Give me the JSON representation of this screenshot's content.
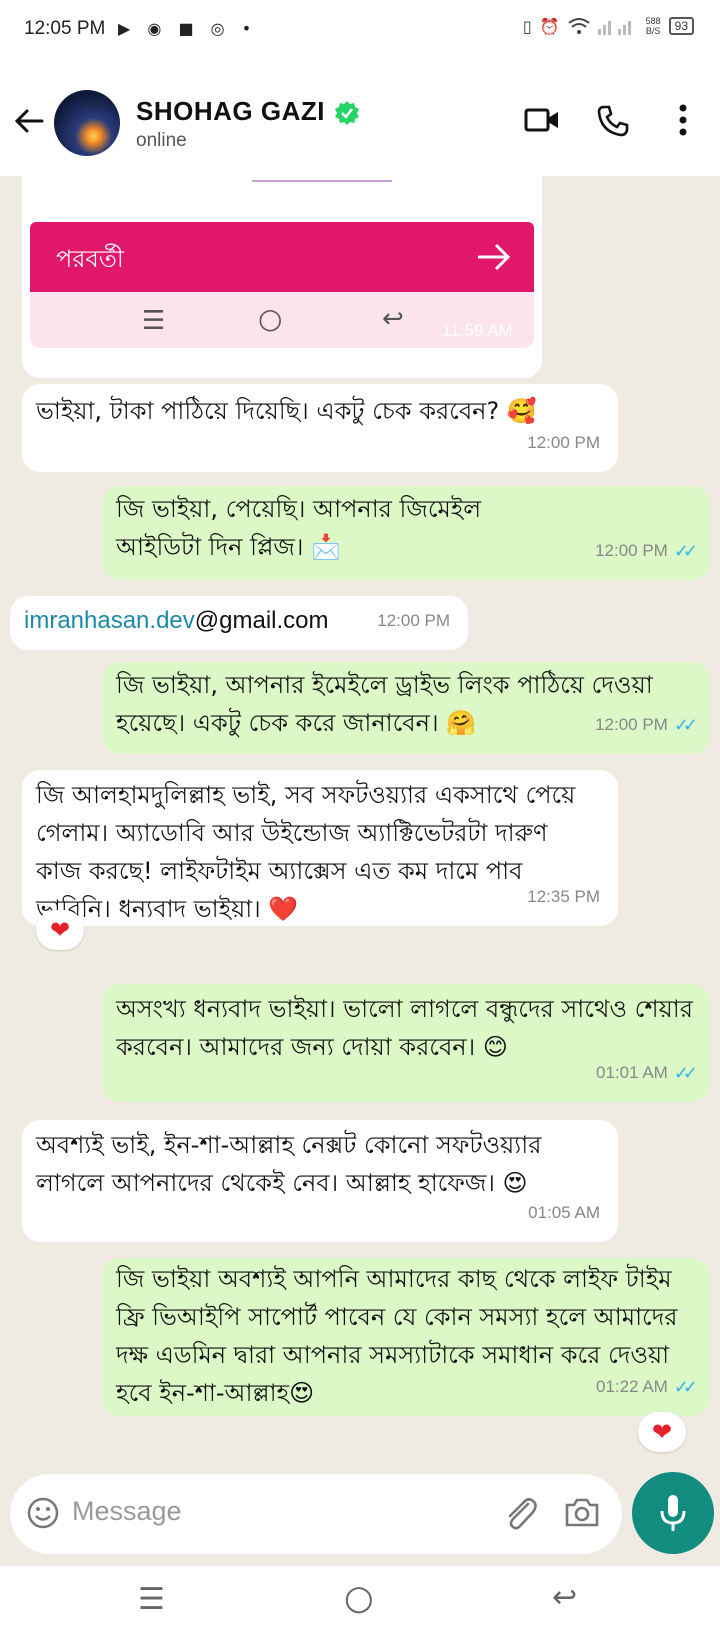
{
  "status_bar": {
    "time": "12:05 PM",
    "net_speed_top": "588",
    "net_speed_bottom": "B/S",
    "battery": "93"
  },
  "header": {
    "contact_name": "SHOHAG GAZI",
    "presence": "online"
  },
  "shared_screenshot": {
    "button_label": "পরবর্তী",
    "time": "11:59 AM"
  },
  "messages": [
    {
      "text": "ভাইয়া, টাকা পাঠিয়ে দিয়েছি। একটু চেক করবেন? 🥰",
      "time": "12:00 PM"
    },
    {
      "text": "জি ভাইয়া, পেয়েছি। আপনার জিমেইল আইডিটা দিন প্লিজ। 📩",
      "time": "12:00 PM"
    },
    {
      "link": "imranhasan.dev",
      "domain": "@gmail.com",
      "time": "12:00 PM"
    },
    {
      "text": "জি ভাইয়া, আপনার ইমেইলে ড্রাইভ লিংক পাঠিয়ে দেওয়া হয়েছে। একটু চেক করে জানাবেন। 🤗",
      "time": "12:00 PM"
    },
    {
      "text": "জি আলহামদুলিল্লাহ ভাই, সব সফটওয়্যার একসাথে পেয়ে গেলাম। অ্যাডোবি আর উইন্ডোজ অ্যাক্টিভেটরটা দারুণ কাজ করছে! লাইফটাইম অ্যাক্সেস এত কম দামে পাব ভাবিনি। ধন্যবাদ ভাইয়া। ❤️",
      "time": "12:35 PM",
      "reaction": "❤"
    },
    {
      "text": "অসংখ্য ধন্যবাদ ভাইয়া। ভালো লাগলে বন্ধুদের সাথেও শেয়ার করবেন। আমাদের জন্য দোয়া করবেন। 😊",
      "time": "01:01 AM"
    },
    {
      "text": "অবশ্যই ভাই, ইন-শা-আল্লাহ নেক্সট কোনো সফটওয়্যার লাগলে আপনাদের থেকেই নেব। আল্লাহ হাফেজ। 😍",
      "time": "01:05 AM"
    },
    {
      "text": "জি ভাইয়া অবশ্যই আপনি আমাদের কাছ থেকে লাইফ টাইম ফ্রি ভিআইপি সাপোর্ট পাবেন যে কোন সমস্যা হলে আমাদের দক্ষ এডমিন দ্বারা আপনার সমস্যাটাকে সমাধান করে দেওয়া হবে ইন-শা-আল্লাহ😍",
      "time": "01:22 AM",
      "reaction": "❤"
    }
  ],
  "composer": {
    "placeholder": "Message"
  },
  "colors": {
    "incoming": "#ffffff",
    "outgoing": "#dcf8c6",
    "accent": "#128c7e",
    "pink_button": "#e0176b",
    "read_ticks": "#34b7f1"
  }
}
